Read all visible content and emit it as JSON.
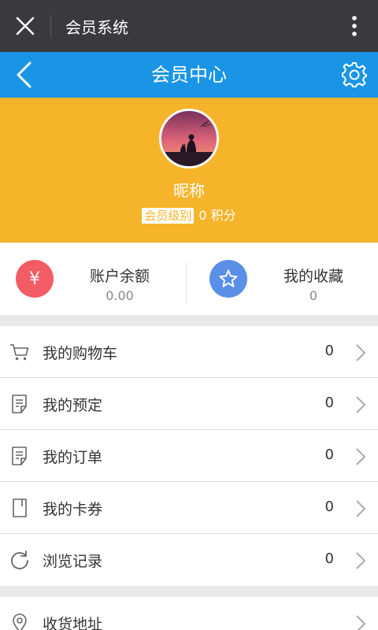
{
  "wechat_bar": {
    "title": "会员系统"
  },
  "nav": {
    "title": "会员中心"
  },
  "profile": {
    "nickname": "昵称",
    "level_label": "会员级别",
    "points": "0 积分"
  },
  "stats": {
    "balance": {
      "label": "账户余额",
      "value": "0.00",
      "icon_glyph": "¥",
      "color": "#f25c64"
    },
    "favorites": {
      "label": "我的收藏",
      "value": "0",
      "color": "#5a8fe8"
    }
  },
  "menu": [
    {
      "label": "我的购物车",
      "count": "0",
      "icon": "cart-icon"
    },
    {
      "label": "我的预定",
      "count": "0",
      "icon": "document-icon"
    },
    {
      "label": "我的订单",
      "count": "0",
      "icon": "document-icon"
    },
    {
      "label": "我的卡券",
      "count": "0",
      "icon": "card-icon"
    },
    {
      "label": "浏览记录",
      "count": "0",
      "icon": "refresh-icon"
    }
  ],
  "address": {
    "label": "收货地址",
    "icon": "location-icon"
  },
  "colors": {
    "wechat_bar": "#3a3a3c",
    "nav": "#1a95e6",
    "profile_bg": "#f6b42b"
  }
}
